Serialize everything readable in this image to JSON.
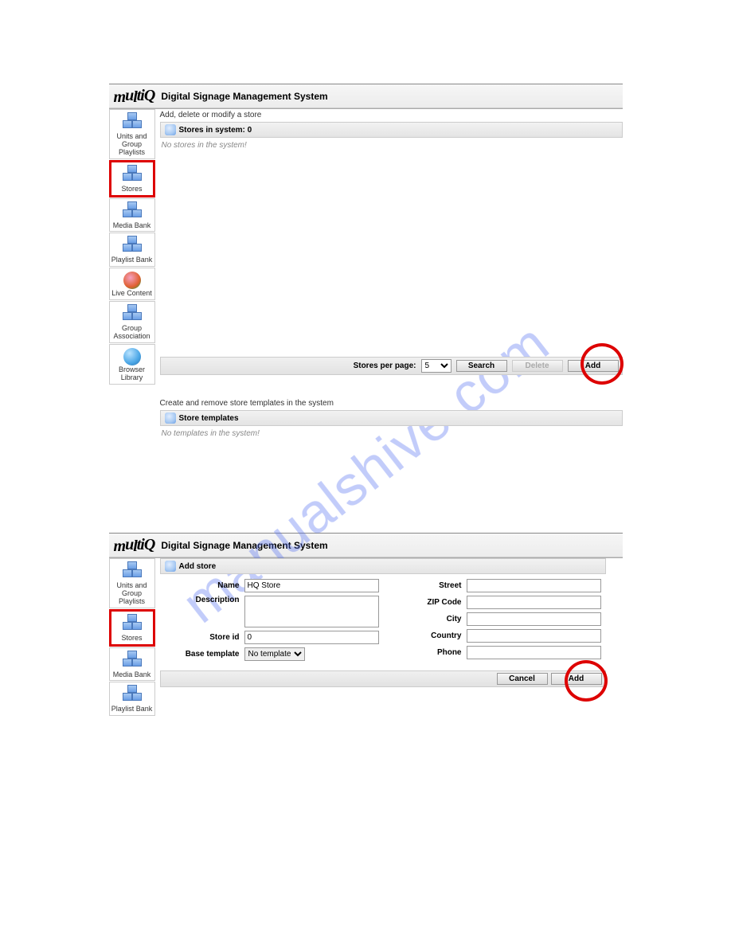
{
  "watermark": "manualshive.com",
  "app": {
    "logo_text": "multiQ",
    "title": "Digital Signage Management System"
  },
  "sidebar": {
    "items": [
      {
        "label": "Units and Group Playlists",
        "icon": "cubes",
        "active": false
      },
      {
        "label": "Stores",
        "icon": "cubes",
        "active": true
      },
      {
        "label": "Media Bank",
        "icon": "cubes",
        "active": false
      },
      {
        "label": "Playlist Bank",
        "icon": "cubes",
        "active": false
      },
      {
        "label": "Live Content",
        "icon": "disc",
        "active": false
      },
      {
        "label": "Group Association",
        "icon": "cubes",
        "active": false
      },
      {
        "label": "Browser Library",
        "icon": "globe",
        "active": false
      }
    ]
  },
  "screen1": {
    "desc1": "Add, delete or modify a store",
    "stores_header": "Stores in system: 0",
    "stores_empty": "No stores in the system!",
    "toolbar": {
      "per_page_label": "Stores per page:",
      "per_page_value": "5",
      "search": "Search",
      "delete": "Delete",
      "add": "Add"
    },
    "desc2": "Create and remove store templates in the system",
    "templates_header": "Store templates",
    "templates_empty": "No templates in the system!"
  },
  "screen2": {
    "form_header": "Add store",
    "fields": {
      "name_label": "Name",
      "name_value": "HQ Store",
      "desc_label": "Description",
      "desc_value": "",
      "storeid_label": "Store id",
      "storeid_value": "0",
      "basetpl_label": "Base template",
      "basetpl_value": "No template",
      "street_label": "Street",
      "street_value": "",
      "zip_label": "ZIP Code",
      "zip_value": "",
      "city_label": "City",
      "city_value": "",
      "country_label": "Country",
      "country_value": "",
      "phone_label": "Phone",
      "phone_value": ""
    },
    "footer": {
      "cancel": "Cancel",
      "add": "Add"
    }
  }
}
